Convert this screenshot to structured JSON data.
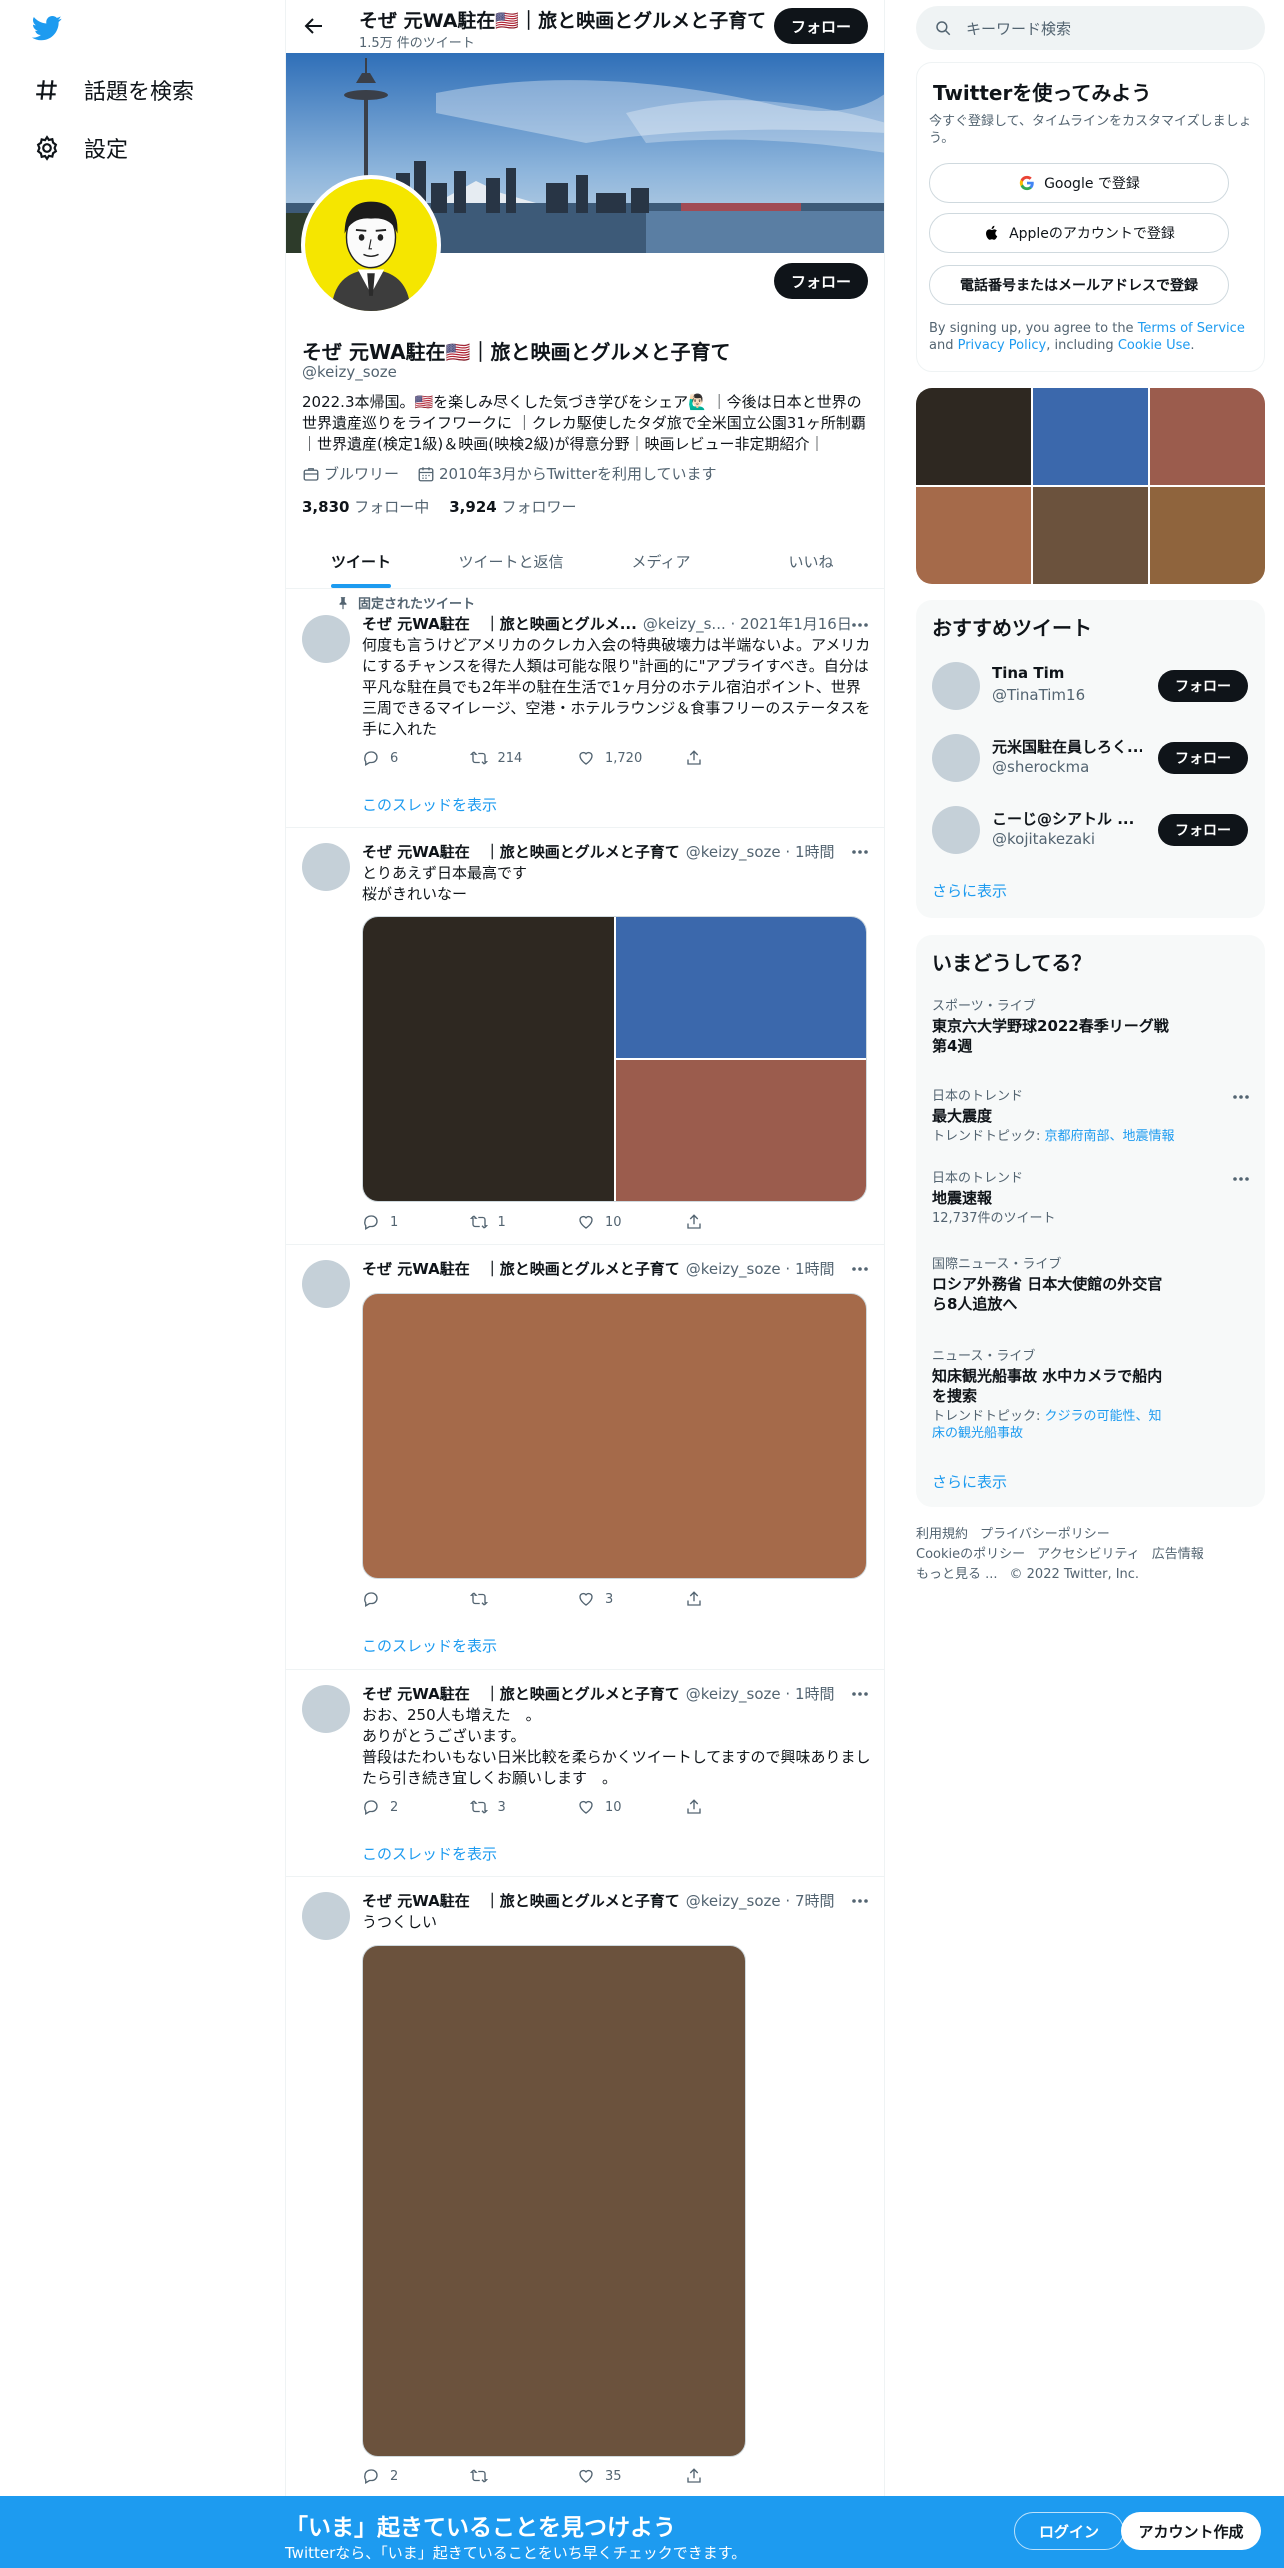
{
  "nav": {
    "explore_label": "話題を検索",
    "settings_label": "設定"
  },
  "profile": {
    "top_name": "そぜ 元WA駐在🇺🇸｜旅と映画とグルメと子育て",
    "tweet_count": "1.5万 件のツイート",
    "follow_label": "フォロー",
    "name": "そぜ 元WA駐在🇺🇸｜旅と映画とグルメと子育て",
    "handle": "@keizy_soze",
    "bio": "2022.3本帰国。🇺🇸を楽しみ尽くした気づき学びをシェア🙋🏻‍♂️ ｜今後は日本と世界の世界遺産巡りをライフワークに ｜クレカ駆使したタダ旅で全米国立公園31ヶ所制覇｜世界遺産(検定1級)＆映画(映検2級)が得意分野｜映画レビュー非定期紹介｜",
    "location": "ブルワリー",
    "joined": "2010年3月からTwitterを利用しています",
    "following_count": "3,830",
    "following_label": "フォロー中",
    "followers_count": "3,924",
    "followers_label": "フォロワー"
  },
  "tabs": [
    "ツイート",
    "ツイートと返信",
    "メディア",
    "いいね"
  ],
  "tweets": [
    {
      "pinned_label": "固定されたツイート",
      "name": "そぜ 元WA駐在　｜旅と映画とグルメ...",
      "handle": "@keizy_s...",
      "time": "2021年1月16日",
      "text": "何度も言うけどアメリカのクレカ入会の特典破壊力は半端ないよ。アメリカにするチャンスを得た人類は可能な限り\"計画的に\"アプライすべき。自分は平凡な駐在員でも2年半の駐在生活で1ヶ月分のホテル宿泊ポイント、世界三周できるマイレージ、空港・ホテルラウンジ＆食事フリーのステータスを手に入れた",
      "replies": "6",
      "retweets": "214",
      "likes": "1,720",
      "thread": "このスレッドを表示"
    },
    {
      "name": "そぜ 元WA駐在　｜旅と映画とグルメと子育て",
      "handle": "@keizy_soze",
      "time": "1時間",
      "text": "とりあえず日本最高です\n桜がきれいなー",
      "replies": "1",
      "retweets": "1",
      "likes": "10"
    },
    {
      "name": "そぜ 元WA駐在　｜旅と映画とグルメと子育て",
      "handle": "@keizy_soze",
      "time": "1時間",
      "replies": "",
      "retweets": "",
      "likes": "3",
      "thread": "このスレッドを表示"
    },
    {
      "name": "そぜ 元WA駐在　｜旅と映画とグルメと子育て",
      "handle": "@keizy_soze",
      "time": "1時間",
      "text": "おお、250人も増えた　。\nありがとうございます。\n普段はたわいもない日米比較を柔らかくツイートしてますので興味ありましたら引き続き宜しくお願いします　。",
      "replies": "2",
      "retweets": "3",
      "likes": "10",
      "thread": "このスレッドを表示"
    },
    {
      "name": "そぜ 元WA駐在　｜旅と映画とグルメと子育て",
      "handle": "@keizy_soze",
      "time": "7時間",
      "text": "うつくしい",
      "replies": "2",
      "retweets": "",
      "likes": "35"
    }
  ],
  "sidebar": {
    "search_placeholder": "キーワード検索",
    "signup": {
      "title": "Twitterを使ってみよう",
      "subtitle": "今すぐ登録して、タイムラインをカスタマイズしましょう。",
      "google": "Google で登録",
      "apple": "Appleのアカウントで登録",
      "phone": "電話番号またはメールアドレスで登録",
      "terms_pre": "By signing up, you agree to the ",
      "terms_link": "Terms of Service",
      "terms_and": " and ",
      "privacy_link": "Privacy Policy",
      "terms_mid": ", including ",
      "cookie_link": "Cookie Use",
      "terms_end": "."
    },
    "recommended": {
      "title": "おすすめツイート",
      "users": [
        {
          "name": "Tina Tim",
          "handle": "@TinaTim16"
        },
        {
          "name": "元米国駐在員しろく...",
          "handle": "@sherockma"
        },
        {
          "name": "こーじ@シアトル ...",
          "handle": "@kojitakezaki"
        }
      ],
      "follow_label": "フォロー",
      "more": "さらに表示"
    },
    "trends": {
      "title": "いまどうしてる？",
      "items": [
        {
          "category": "スポーツ・ライブ",
          "title": "東京六大学野球2022春季リーグ戦　第4週",
          "sub": "",
          "link": ""
        },
        {
          "category": "日本のトレンド",
          "title": "最大震度",
          "sub": "トレンドトピック: ",
          "link": "京都府南部、地震情報"
        },
        {
          "category": "日本のトレンド",
          "title": "地震速報",
          "sub": "12,737件のツイート",
          "link": ""
        },
        {
          "category": "国際ニュース・ライブ",
          "title": "ロシア外務省 日本大使館の外交官ら8人追放へ",
          "sub": "",
          "link": ""
        },
        {
          "category": "ニュース・ライブ",
          "title": "知床観光船事故 水中カメラで船内を捜索",
          "sub": "トレンドトピック: ",
          "link": "クジラの可能性、知床の観光船事故"
        }
      ],
      "more": "さらに表示"
    },
    "footer": {
      "links": [
        "利用規約",
        "プライバシーポリシー",
        "Cookieのポリシー",
        "アクセシビリティ",
        "広告情報",
        "もっと見る ..."
      ],
      "copyright": "© 2022 Twitter, Inc."
    }
  },
  "bottom": {
    "title": "「いま」起きていることを見つけよう",
    "subtitle": "Twitterなら、「いま」起きていることをいち早くチェックできます。",
    "login": "ログイン",
    "signup": "アカウント作成"
  },
  "colors": {
    "accent": "#1d9bf0",
    "media_dark": "#2e2821",
    "media_blue": "#3b68ac",
    "media_red": "#9b5c4d",
    "media_orange": "#a56a4a",
    "media_brown": "#6b523d",
    "media_tan": "#8f643d"
  }
}
